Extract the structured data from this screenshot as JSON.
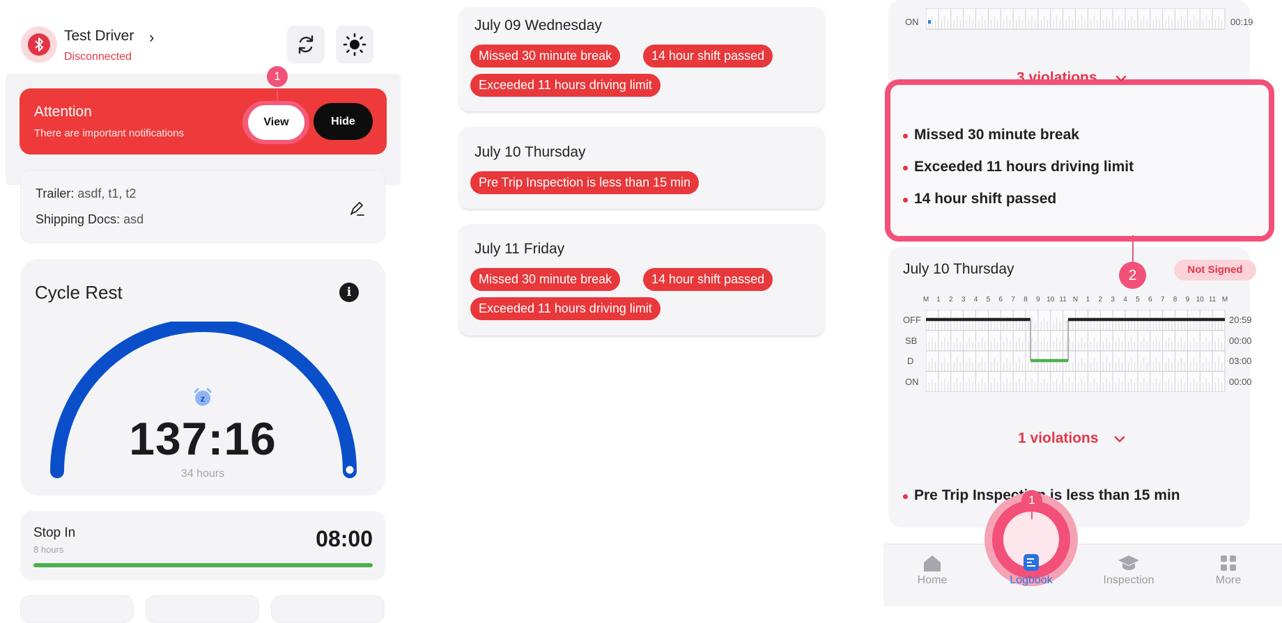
{
  "header": {
    "driver_name": "Test Driver",
    "connection_status": "Disconnected",
    "chevron": "›"
  },
  "attention": {
    "title": "Attention",
    "message": "There are important notifications",
    "view_label": "View",
    "hide_label": "Hide",
    "step_badge": "1"
  },
  "trailer": {
    "trailer_label": "Trailer:",
    "trailer_value": "asdf, t1, t2",
    "docs_label": "Shipping Docs:",
    "docs_value": "asd"
  },
  "cycle": {
    "title": "Cycle Rest",
    "value": "137:16",
    "subtitle": "34 hours",
    "info_glyph": "i",
    "timer_glyph": "z"
  },
  "stop_in": {
    "title": "Stop In",
    "subtitle": "8 hours",
    "value": "08:00",
    "progress": 1.0
  },
  "day_cards": [
    {
      "title": "July 09 Wednesday",
      "violations": [
        "Missed 30 minute break",
        "14 hour shift passed",
        "Exceeded 11 hours driving limit"
      ]
    },
    {
      "title": "July 10 Thursday",
      "violations": [
        "Pre Trip Inspection is less than 15 min"
      ]
    },
    {
      "title": "July 11 Friday",
      "violations": [
        "Missed 30 minute break",
        "14 hour shift passed",
        "Exceeded 11 hours driving limit"
      ]
    }
  ],
  "log_top": {
    "on_label": "ON",
    "on_total": "00:19",
    "violations_toggle": "3 violations",
    "violations": [
      "Missed 30 minute break",
      "Exceeded 11 hours driving limit",
      "14 hour shift passed"
    ],
    "step_badge": "2"
  },
  "log_day": {
    "title": "July 10 Thursday",
    "status": "Not Signed",
    "hours": [
      "M",
      "1",
      "2",
      "3",
      "4",
      "5",
      "6",
      "7",
      "8",
      "9",
      "10",
      "11",
      "N",
      "1",
      "2",
      "3",
      "4",
      "5",
      "6",
      "7",
      "8",
      "9",
      "10",
      "11",
      "M"
    ],
    "rows": [
      {
        "label": "OFF",
        "total": "20:59"
      },
      {
        "label": "SB",
        "total": "00:00"
      },
      {
        "label": "D",
        "total": "03:00"
      },
      {
        "label": "ON",
        "total": "00:00"
      }
    ],
    "violations_toggle": "1 violations",
    "violations": [
      "Pre Trip Inspection is less than 15 min"
    ]
  },
  "tabbar": {
    "tabs": [
      {
        "label": "Home",
        "icon": "home-icon"
      },
      {
        "label": "Logbook",
        "icon": "logbook-icon"
      },
      {
        "label": "Inspection",
        "icon": "inspection-icon"
      },
      {
        "label": "More",
        "icon": "grid-icon"
      }
    ],
    "step_badge": "1"
  },
  "colors": {
    "accent_red": "#e8383b",
    "highlight_pink": "#f25078",
    "gauge_blue": "#0a4fc9",
    "progress_green": "#4cb04c"
  }
}
